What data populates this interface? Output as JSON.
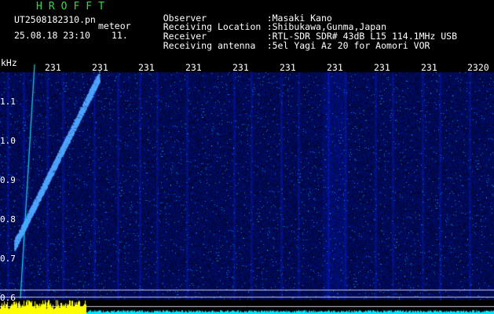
{
  "app": {
    "name": "HROFFT"
  },
  "file": {
    "filename": "UT2508182310.pn",
    "mode": "meteor",
    "datetime": "25.08.18 23:10",
    "seconds": "11."
  },
  "info": [
    {
      "label": "Observer",
      "value": ":Masaki Kano"
    },
    {
      "label": "Receiving Location",
      "value": ":Shibukawa,Gunma,Japan"
    },
    {
      "label": "Receiver",
      "value": ":RTL-SDR SDR# 43dB L15 114.1MHz USB"
    },
    {
      "label": "Receiving antenna",
      "value": ":5el Yagi Az 20 for Aomori VOR"
    }
  ],
  "axis": {
    "y_unit": "kHz",
    "y_ticks": [
      "1.1",
      "1.0",
      "0.9",
      "0.8",
      "0.7",
      "0.6"
    ],
    "x_ticks": [
      "231",
      "231",
      "231",
      "231",
      "231",
      "231",
      "231",
      "231",
      "231",
      "2320"
    ]
  },
  "colors": {
    "background": "#000000",
    "noise": "#0a0a6e",
    "echo": "#4fa6ff",
    "signal_line": "#18c8e8",
    "level_trace": "#ffff00",
    "level_baseline": "#00e5ff",
    "reference_lines": "#c8c8e6",
    "title": "#22e43a"
  }
}
